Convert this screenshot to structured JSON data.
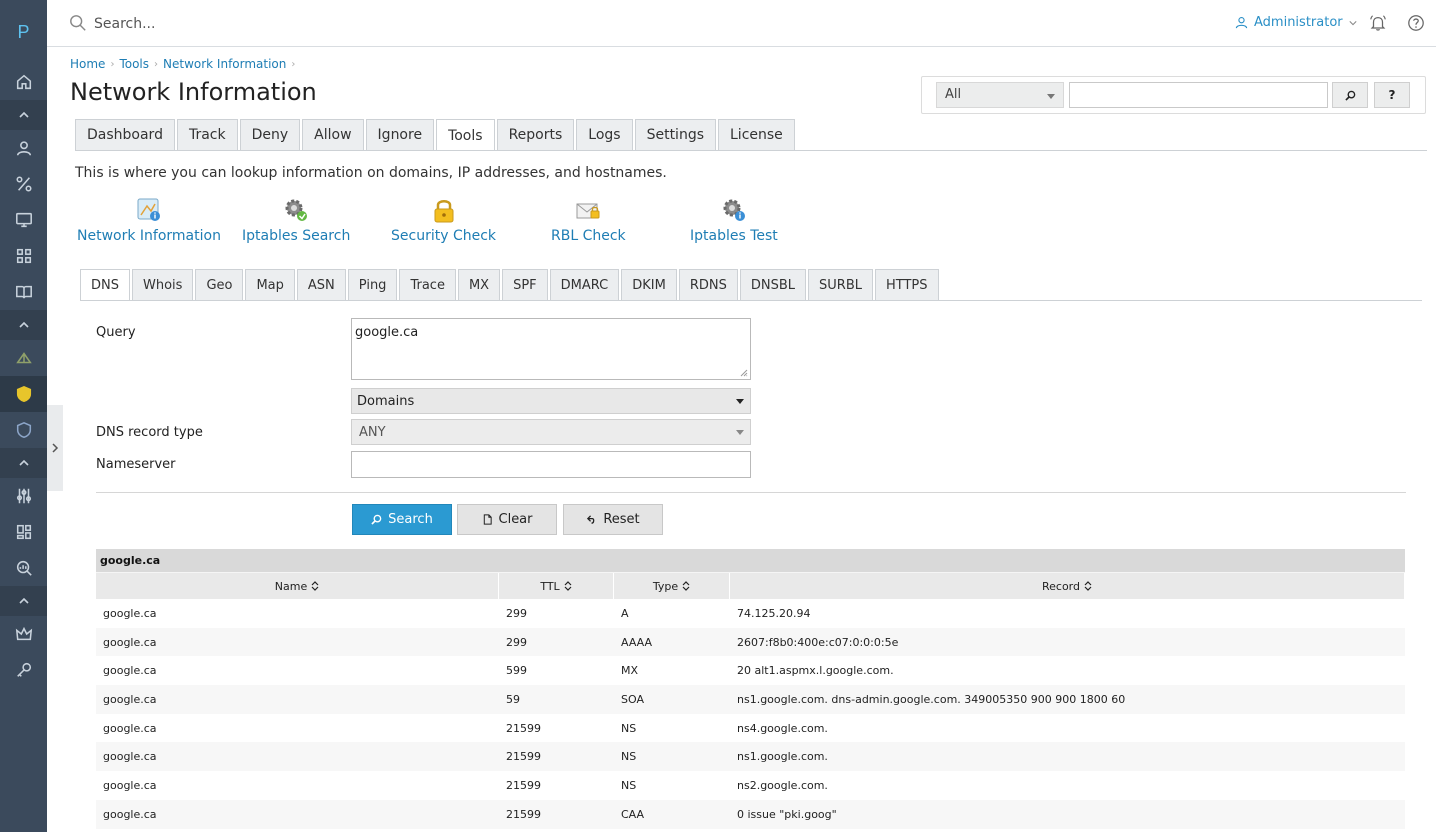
{
  "app": {
    "logo_letter": "P"
  },
  "topbar": {
    "search_placeholder": "Search...",
    "user_label": "Administrator"
  },
  "breadcrumb": [
    "Home",
    "Tools",
    "Network Information"
  ],
  "page_title": "Network Information",
  "quicksearch": {
    "scope": "All",
    "search_btn_icon": "search-icon",
    "help_label": "?"
  },
  "tabs": [
    "Dashboard",
    "Track",
    "Deny",
    "Allow",
    "Ignore",
    "Tools",
    "Reports",
    "Logs",
    "Settings",
    "License"
  ],
  "active_tab": "Tools",
  "intro_text": "This is where you can lookup information on domains, IP addresses, and hostnames.",
  "tools": [
    {
      "label": "Network Information",
      "icon": "network-info-icon"
    },
    {
      "label": "Iptables Search",
      "icon": "gear-info-icon"
    },
    {
      "label": "Security Check",
      "icon": "padlock-icon"
    },
    {
      "label": "RBL Check",
      "icon": "mail-lock-icon"
    },
    {
      "label": "Iptables Test",
      "icon": "gear-info-icon"
    }
  ],
  "subtabs": [
    "DNS",
    "Whois",
    "Geo",
    "Map",
    "ASN",
    "Ping",
    "Trace",
    "MX",
    "SPF",
    "DMARC",
    "DKIM",
    "RDNS",
    "DNSBL",
    "SURBL",
    "HTTPS"
  ],
  "active_subtab": "DNS",
  "form": {
    "query_label": "Query",
    "query_value": "google.ca",
    "query_kind": "Domains",
    "record_type_label": "DNS record type",
    "record_type_value": "ANY",
    "nameserver_label": "Nameserver",
    "nameserver_value": ""
  },
  "buttons": {
    "search": "Search",
    "clear": "Clear",
    "reset": "Reset"
  },
  "results": {
    "caption": "google.ca",
    "columns": [
      "Name",
      "TTL",
      "Type",
      "Record"
    ],
    "rows": [
      [
        "google.ca",
        "299",
        "A",
        "74.125.20.94"
      ],
      [
        "google.ca",
        "299",
        "AAAA",
        "2607:f8b0:400e:c07:0:0:0:5e"
      ],
      [
        "google.ca",
        "599",
        "MX",
        "20 alt1.aspmx.l.google.com."
      ],
      [
        "google.ca",
        "59",
        "SOA",
        "ns1.google.com. dns-admin.google.com. 349005350 900 900 1800 60"
      ],
      [
        "google.ca",
        "21599",
        "NS",
        "ns4.google.com."
      ],
      [
        "google.ca",
        "21599",
        "NS",
        "ns1.google.com."
      ],
      [
        "google.ca",
        "21599",
        "NS",
        "ns2.google.com."
      ],
      [
        "google.ca",
        "21599",
        "CAA",
        "0 issue \"pki.goog\""
      ]
    ]
  },
  "colors": {
    "rail_bg": "#3b4a5c",
    "accent_link": "#1e7db4",
    "primary_button": "#2b9ad2",
    "logo": "#5ec2ef"
  }
}
